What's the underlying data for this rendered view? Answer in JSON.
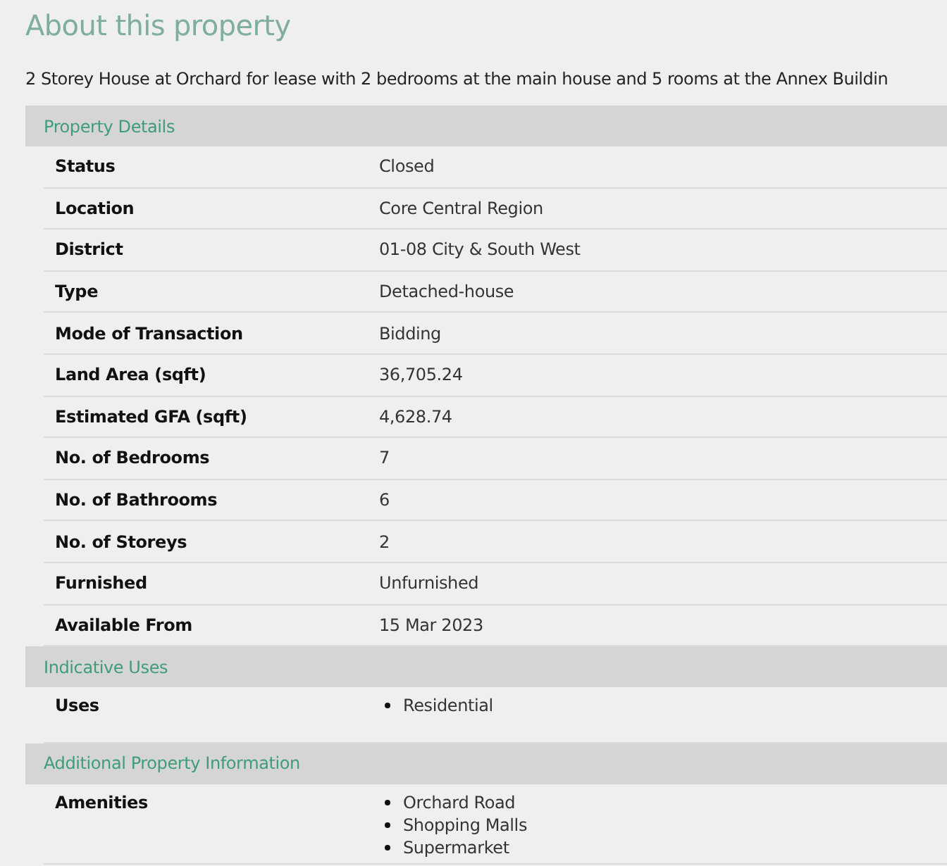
{
  "title": "About this property",
  "description": "2 Storey House at Orchard for lease with 2 bedrooms at the main house and 5 rooms at the Annex Buildin",
  "sections": [
    {
      "heading": "Property Details",
      "rows": [
        {
          "label": "Status",
          "kind": "text",
          "value": "Closed"
        },
        {
          "label": "Location",
          "kind": "text",
          "value": "Core Central Region"
        },
        {
          "label": "District",
          "kind": "text",
          "value": "01-08 City & South West"
        },
        {
          "label": "Type",
          "kind": "text",
          "value": "Detached-house"
        },
        {
          "label": "Mode of Transaction",
          "kind": "text",
          "value": "Bidding"
        },
        {
          "label": "Land Area (sqft)",
          "kind": "text",
          "value": "36,705.24"
        },
        {
          "label": "Estimated GFA (sqft)",
          "kind": "text",
          "value": "4,628.74"
        },
        {
          "label": "No. of Bedrooms",
          "kind": "text",
          "value": "7"
        },
        {
          "label": "No. of Bathrooms",
          "kind": "text",
          "value": "6"
        },
        {
          "label": "No. of Storeys",
          "kind": "text",
          "value": "2"
        },
        {
          "label": "Furnished",
          "kind": "text",
          "value": "Unfurnished"
        },
        {
          "label": "Available From",
          "kind": "text",
          "value": "15 Mar 2023"
        }
      ]
    },
    {
      "heading": "Indicative Uses",
      "rows": [
        {
          "label": "Uses",
          "kind": "list",
          "items": [
            "Residential"
          ]
        }
      ]
    },
    {
      "heading": "Additional Property Information",
      "rows": [
        {
          "label": "Amenities",
          "kind": "list",
          "items": [
            "Orchard Road",
            "Shopping Malls",
            "Supermarket"
          ]
        }
      ]
    }
  ]
}
